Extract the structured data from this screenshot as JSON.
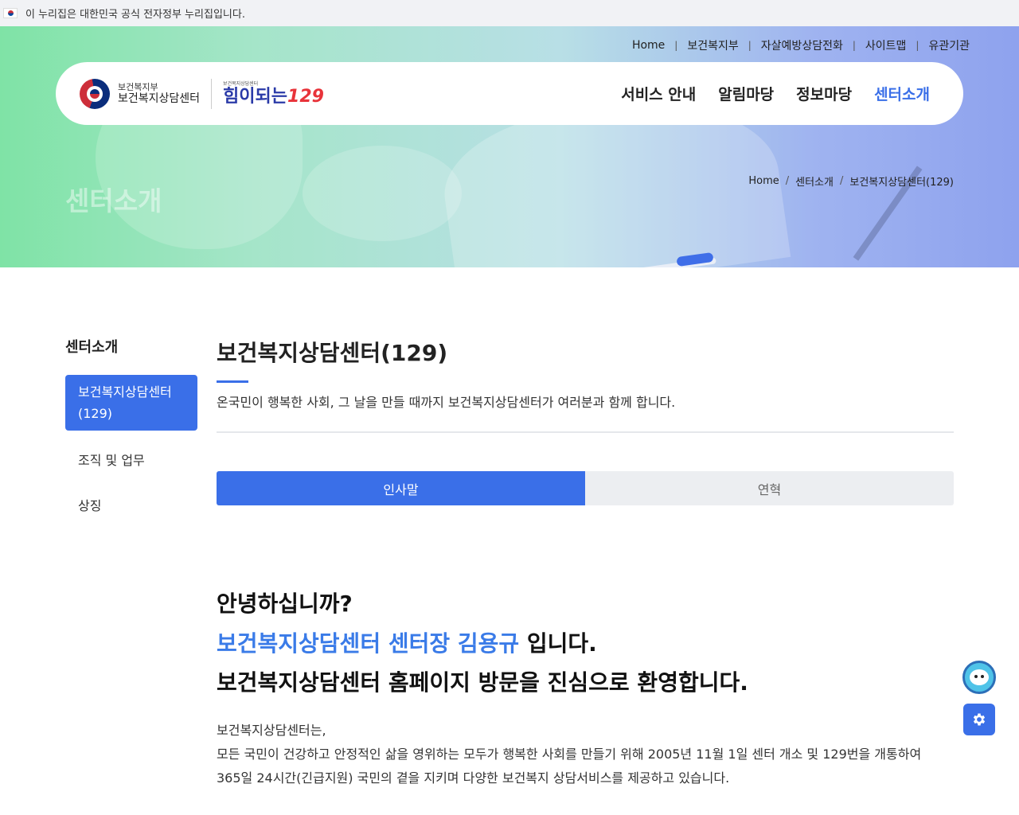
{
  "gov_notice": "이 누리집은 대한민국 공식 전자정부 누리집입니다.",
  "util_nav": [
    "Home",
    "보건복지부",
    "자살예방상담전화",
    "사이트맵",
    "유관기관"
  ],
  "logo": {
    "ministry": "보건복지부",
    "center": "보건복지상담센터",
    "tagline_small": "보건복지상담센터",
    "tagline": "힘이되는",
    "number": "129"
  },
  "main_nav": [
    "서비스 안내",
    "알림마당",
    "정보마당",
    "센터소개"
  ],
  "hero": {
    "title": "센터소개",
    "breadcrumb": [
      "Home",
      "센터소개",
      "보건복지상담센터(129)"
    ]
  },
  "side_menu": {
    "title": "센터소개",
    "items": [
      "보건복지상담센터(129)",
      "조직 및 업무",
      "상징"
    ]
  },
  "content": {
    "title": "보건복지상담센터(129)",
    "description": "온국민이 행복한 사회, 그 날을 만들 때까지 보건복지상담센터가 여러분과 함께 합니다.",
    "tabs": [
      "인사말",
      "연혁"
    ],
    "greeting_line1": "안녕하십니까?",
    "greeting_line2_blue": "보건복지상담센터 센터장 김용규",
    "greeting_line2_rest": " 입니다.",
    "greeting_line3": "보건복지상담센터 홈페이지 방문을 진심으로 환영합니다.",
    "body": [
      "보건복지상담센터는,",
      "모든 국민이 건강하고 안정적인 삶을 영위하는 모두가 행복한 사회를 만들기 위해 2005년 11월 1일 센터 개소 및 129번을 개통하여",
      "365일 24시간(긴급지원) 국민의 곁을 지키며 다양한 보건복지 상담서비스를 제공하고 있습니다."
    ]
  },
  "colors": {
    "accent": "#3a6fe8",
    "greeting_blue": "#3a7be8"
  },
  "icons": {
    "flag": "korea-flag-icon",
    "mascot": "chatbot-mascot-icon",
    "settings": "gear-icon"
  }
}
